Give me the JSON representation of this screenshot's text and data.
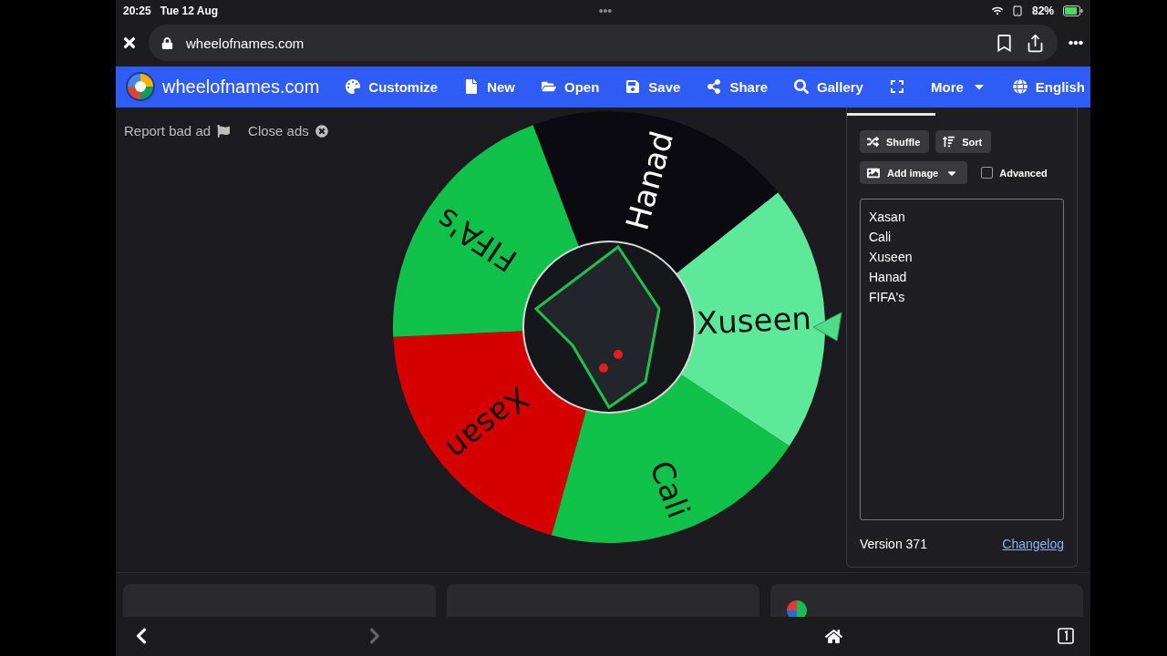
{
  "status_bar": {
    "time": "20:25",
    "date": "Tue 12 Aug",
    "battery": "82%"
  },
  "browser": {
    "url": "wheelofnames.com"
  },
  "nav": {
    "brand": "wheelofnames.com",
    "items": [
      {
        "kind": "link",
        "label": "Customize"
      },
      {
        "kind": "link",
        "label": "New"
      },
      {
        "kind": "link",
        "label": "Open"
      },
      {
        "kind": "link",
        "label": "Save"
      },
      {
        "kind": "link",
        "label": "Share"
      },
      {
        "kind": "link",
        "label": "Gallery"
      },
      {
        "kind": "icon"
      },
      {
        "kind": "dropdown",
        "label": "More"
      },
      {
        "kind": "link",
        "label": "English"
      }
    ]
  },
  "ad_links": [
    "Report bad ad",
    "Close ads"
  ],
  "wheel": {
    "slices": [
      {
        "label": "Xasan",
        "color": "#d50000"
      },
      {
        "label": "Cali",
        "color": "#11c24a"
      },
      {
        "label": "Xuseen",
        "color": "#5ee89a"
      },
      {
        "label": "Hanad",
        "color": "#0a0a10"
      },
      {
        "label": "FIFA's",
        "color": "#11c24a"
      }
    ]
  },
  "panel": {
    "shuffle": "Shuffle",
    "sort": "Sort",
    "add_image": "Add image",
    "advanced": {
      "label": "Advanced",
      "checked": false
    },
    "entries": [
      "Xasan",
      "Cali",
      "Xuseen",
      "Hanad",
      "FIFA's"
    ],
    "version": "Version 371",
    "changelog": "Changelog"
  }
}
